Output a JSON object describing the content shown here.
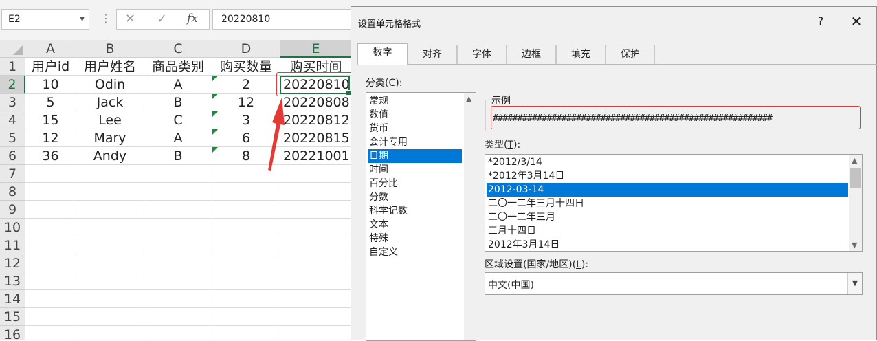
{
  "formula_bar": {
    "name_box": "E2",
    "formula": "20220810"
  },
  "sheet": {
    "columns": [
      "A",
      "B",
      "C",
      "D",
      "E"
    ],
    "rows": [
      "1",
      "2",
      "3",
      "4",
      "5",
      "6",
      "7",
      "8",
      "9",
      "10",
      "11",
      "12",
      "13",
      "14",
      "15",
      "16"
    ],
    "header_row": [
      "用户id",
      "用户姓名",
      "商品类别",
      "购买数量",
      "购买时间"
    ],
    "data": [
      [
        "10",
        "Odin",
        "A",
        "2",
        "20220810"
      ],
      [
        "5",
        "Jack",
        "B",
        "12",
        "20220808"
      ],
      [
        "15",
        "Lee",
        "C",
        "3",
        "20220812"
      ],
      [
        "12",
        "Mary",
        "A",
        "6",
        "20220815"
      ],
      [
        "36",
        "Andy",
        "B",
        "8",
        "20221001"
      ]
    ],
    "selected_cell": "E2"
  },
  "dialog": {
    "title": "设置单元格格式",
    "help": "?",
    "close": "✕",
    "tabs": [
      "数字",
      "对齐",
      "字体",
      "边框",
      "填充",
      "保护"
    ],
    "category_label_pre": "分类(",
    "category_label_key": "C",
    "category_label_post": "):",
    "categories": [
      "常规",
      "数值",
      "货币",
      "会计专用",
      "日期",
      "时间",
      "百分比",
      "分数",
      "科学记数",
      "文本",
      "特殊",
      "自定义"
    ],
    "selected_category": "日期",
    "sample_label": "示例",
    "sample_value": "#########################################################",
    "type_label_pre": "类型(",
    "type_label_key": "T",
    "type_label_post": "):",
    "types": [
      "*2012/3/14",
      "*2012年3月14日",
      "2012-03-14",
      "二〇一二年三月十四日",
      "二〇一二年三月",
      "三月十四日",
      "2012年3月14日"
    ],
    "selected_type": "2012-03-14",
    "locale_label_pre": "区域设置(国家/地区)(",
    "locale_label_key": "L",
    "locale_label_post": "):",
    "locale_value": "中文(中国)"
  }
}
